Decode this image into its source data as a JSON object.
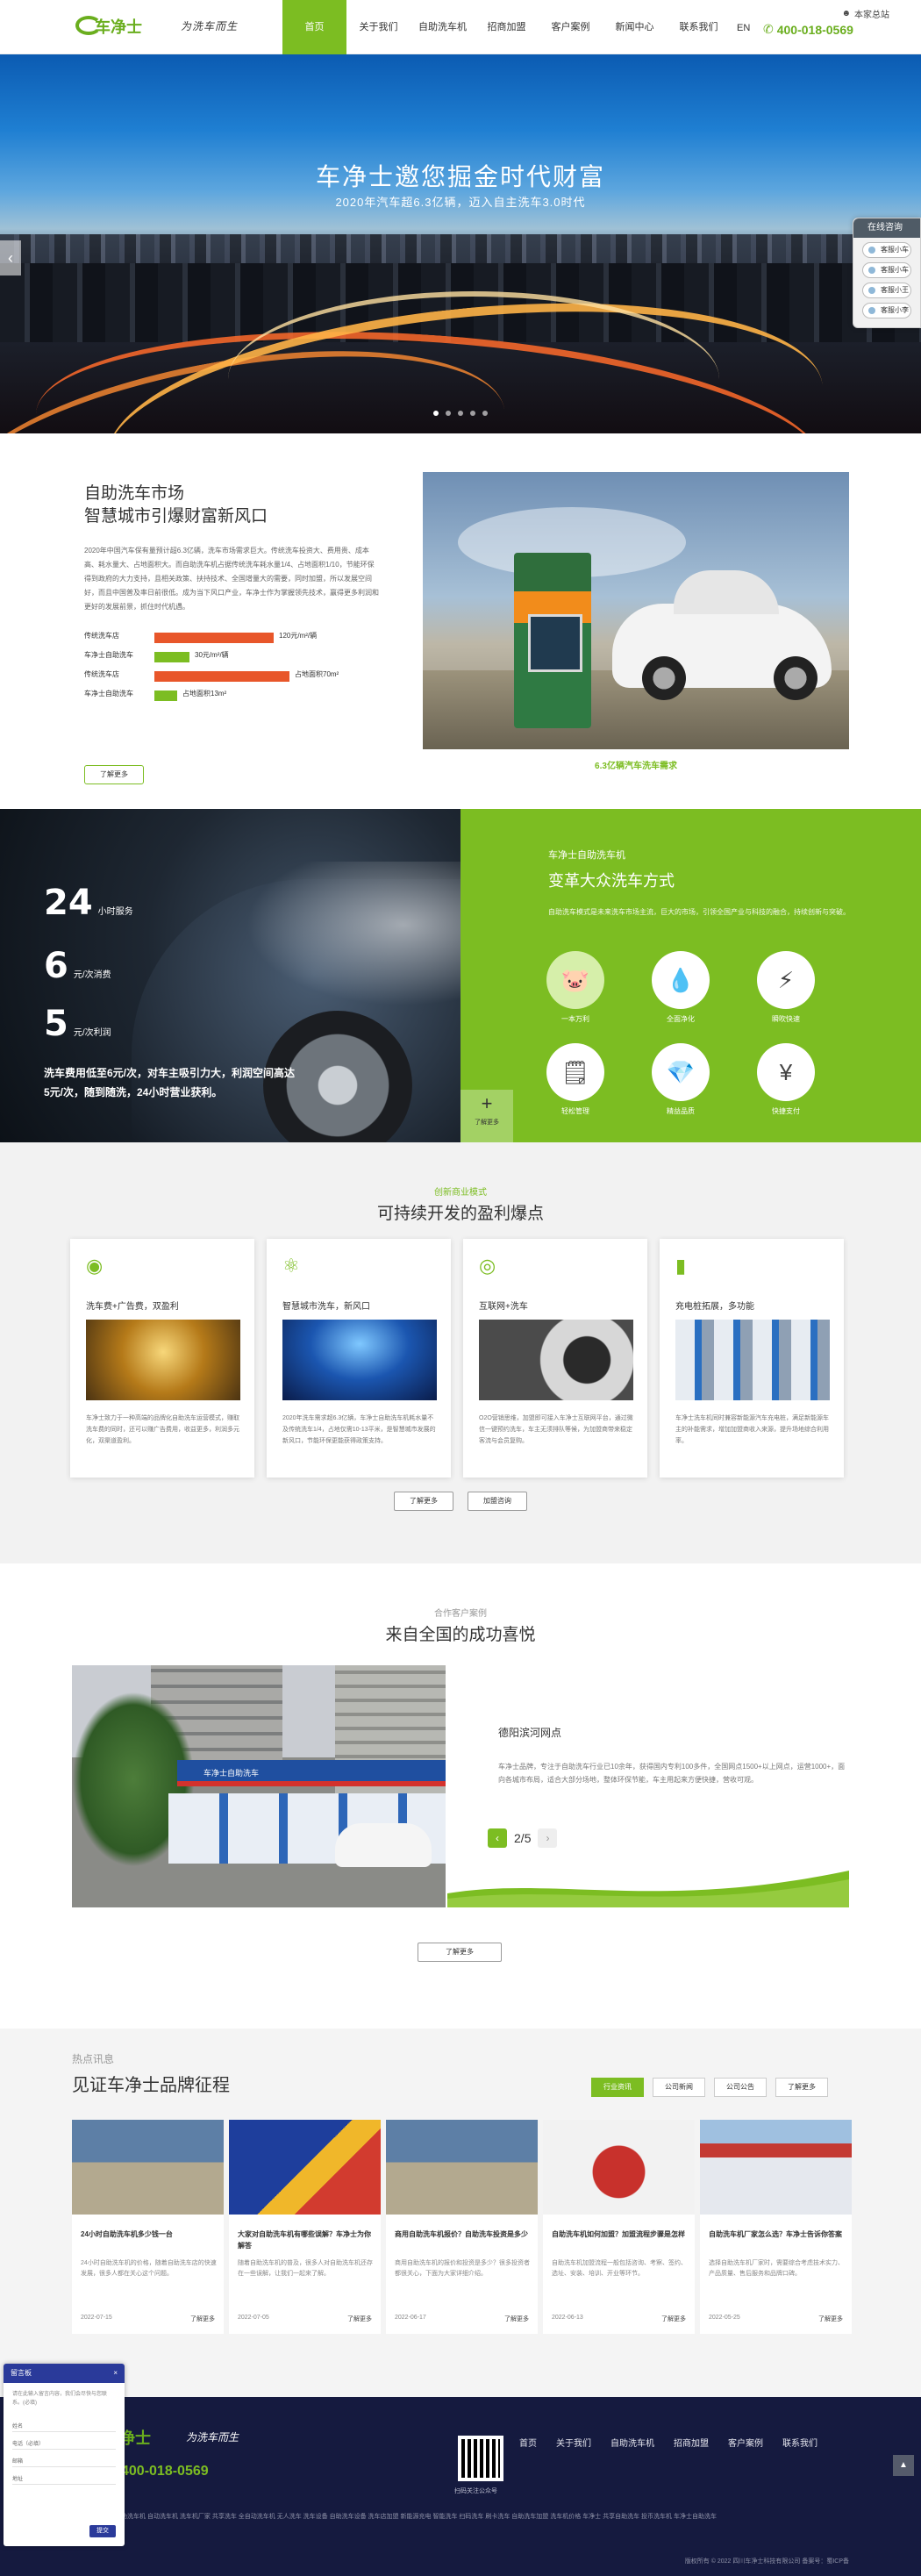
{
  "header": {
    "brand": "车净士",
    "slogan": "为洗车而生",
    "nav": [
      "首页",
      "关于我们",
      "自助洗车机",
      "招商加盟",
      "客户案例",
      "新闻中心",
      "联系我们"
    ],
    "hq_link": "本家总站",
    "lang": "EN",
    "hotline": "400-018-0569"
  },
  "banner": {
    "title": "车净士邀您掘金时代财富",
    "subtitle": "2020年汽车超6.3亿辆，迈入自主洗车3.0时代",
    "prev": "‹",
    "next": "›"
  },
  "float_panel": {
    "title": "在线咨询",
    "items": [
      "客服小车",
      "客服小车",
      "客服小王",
      "客服小李"
    ]
  },
  "market": {
    "title_line1": "自助洗车市场",
    "title_line2": "智慧城市引爆财富新风口",
    "desc": "2020年中国汽车保有量预计超6.3亿辆，洗车市场需求巨大。传统洗车投资大、费用贵、成本高、耗水量大、占地面积大。而自助洗车机占据传统洗车耗水量1/4、占地面积1/10，节能环保得到政府的大力支持，且相关政策、扶持技术、全国增量大的需要，同时加盟，所以发展空间好，而且中国普及率日前很低。成为当下风口产业，车净士作为掌握领先技术，赢得更多利润和更好的发展前景，抓住时代机遇。",
    "bars": [
      {
        "label": "传统洗车店",
        "value": "120元/m²/辆",
        "fill": 0.62,
        "color": "#e8562a"
      },
      {
        "label": "车净士自助洗车",
        "value": "30元/m²/辆",
        "fill": 0.18,
        "color": "#7cbd22"
      },
      {
        "label": "传统洗车店",
        "value": "占地面积70m²",
        "fill": 0.7,
        "color": "#e8562a"
      },
      {
        "label": "车净士自助洗车",
        "value": "占地面积13m²",
        "fill": 0.12,
        "color": "#7cbd22"
      }
    ],
    "learn_more": "了解更多",
    "photo_caption": "6.3亿辆汽车洗车需求"
  },
  "stats": {
    "items": [
      {
        "num": "24",
        "unit": "小时服务"
      },
      {
        "num": "6",
        "unit": "元/次消费"
      },
      {
        "num": "5",
        "unit": "元/次利润"
      }
    ],
    "text": "洗车费用低至6元/次，对车主吸引力大，利润空间高达5元/次，随到随洗，24小时营业获利。",
    "pre": "车净士自助洗车机",
    "title": "变革大众洗车方式",
    "desc": "自助洗车模式是未来洗车市场主流，巨大的市场，引领全国产业与科技的融合，持续创新与突破。",
    "features": [
      {
        "icon": "piggy-bank-icon",
        "glyph": "🐷",
        "label": "一本万利"
      },
      {
        "icon": "water-drops-icon",
        "glyph": "💧",
        "label": "全面净化"
      },
      {
        "icon": "lightning-icon",
        "glyph": "⚡",
        "label": "瞬吹快速"
      },
      {
        "icon": "document-edit-icon",
        "glyph": "🗒",
        "label": "轻松管理"
      },
      {
        "icon": "diamond-icon",
        "glyph": "💎",
        "label": "精益品质"
      },
      {
        "icon": "yuan-coin-icon",
        "glyph": "¥",
        "label": "快捷支付"
      }
    ],
    "corner_text": "了解更多"
  },
  "profit": {
    "pre": "创新商业模式",
    "title": "可持续开发的盈利爆点",
    "cards": [
      {
        "icon": "coins-icon",
        "title": "洗车费+广告费，双盈利",
        "desc": "车净士致力于一种高端的品牌化自助洗车运营模式，赚取洗车费的同时，还可以赚广告费用，收益更多，利润多元化，双渠道盈利。"
      },
      {
        "icon": "atom-network-icon",
        "title": "智慧城市洗车，新风口",
        "desc": "2020年洗车需求超6.3亿辆，车净士自助洗车机耗水量不及传统洗车1/4，占地仅需10-13平米，是智慧城市发展的新风口，节能环保更能获得政策支持。"
      },
      {
        "icon": "globe-icon",
        "title": "互联网+洗车",
        "desc": "O2O营销思维，加盟即可接入车净士互联网平台，通过微信一键预约洗车，车主无须排队等候，为加盟商带来稳定客流与会员复购。"
      },
      {
        "icon": "battery-charge-icon",
        "title": "充电桩拓展，多功能",
        "desc": "车净士洗车机同时兼容新能源汽车充电桩，满足新能源车主的补能需求，增加加盟商收入来源，提升场地综合利用率。"
      }
    ],
    "btn_more": "了解更多",
    "btn_join": "加盟咨询"
  },
  "cases": {
    "pre": "合作客户案例",
    "title": "来自全国的成功喜悦",
    "canopy_text": "车净士自助洗车",
    "case_title": "德阳滨河网点",
    "case_desc": "车净士品牌，专注于自助洗车行业已10余年，获得国内专利100多件，全国网点1500+以上网点，运营1000+，面向各城市布局，适合大部分场地，整体环保节能，车主用起来方便快捷，营收可观。",
    "page_current": "2",
    "page_total": "5",
    "more": "了解更多"
  },
  "news": {
    "pre": "热点讯息",
    "title": "见证车净士品牌征程",
    "tabs": [
      "行业资讯",
      "公司新闻",
      "公司公告",
      "了解更多"
    ],
    "items": [
      {
        "title": "24小时自助洗车机多少钱一台",
        "desc": "24小时自助洗车机的价格，随着自助洗车店的快速发展，很多人都在关心这个问题。",
        "date": "2022-07-15",
        "more": "了解更多"
      },
      {
        "title": "大家对自助洗车机有哪些误解？车净士为你解答",
        "desc": "随着自助洗车机的普及，很多人对自助洗车机还存在一些误解，让我们一起来了解。",
        "date": "2022-07-05",
        "more": "了解更多"
      },
      {
        "title": "商用自助洗车机报价？自助洗车投资是多少",
        "desc": "商用自助洗车机的报价和投资是多少？很多投资者都很关心，下面为大家详细介绍。",
        "date": "2022-06-17",
        "more": "了解更多"
      },
      {
        "title": "自助洗车机如何加盟？加盟流程步骤是怎样",
        "desc": "自助洗车机加盟流程一般包括咨询、考察、签约、选址、安装、培训、开业等环节。",
        "date": "2022-06-13",
        "more": "了解更多"
      },
      {
        "title": "自助洗车机厂家怎么选？车净士告诉你答案",
        "desc": "选择自助洗车机厂家时，需要综合考虑技术实力、产品质量、售后服务和品牌口碑。",
        "date": "2022-05-25",
        "more": "了解更多"
      }
    ]
  },
  "footer": {
    "phone": "400-018-0569",
    "qr_label": "扫码关注公众号",
    "nav": [
      "首页",
      "关于我们",
      "自助洗车机",
      "招商加盟",
      "客户案例",
      "联系我们"
    ],
    "links": "友情链接：自助洗车机  自动洗车机  洗车机厂家  共享洗车  全自动洗车机  无人洗车  洗车设备  自助洗车设备  洗车店加盟  新能源充电  智能洗车  扫码洗车  刷卡洗车  自助洗车加盟  洗车机价格  车净士  共享自助洗车  投币洗车机  车净士自助洗车",
    "copyright": "版权所有 © 2022 四川车净士科技有限公司  备案号：蜀ICP备"
  },
  "message": {
    "title": "留言板",
    "close": "×",
    "intro": "请在此输入留言内容，我们会尽快与您联系。(必填)",
    "fields": [
      "姓名",
      "电话（必填）",
      "邮箱",
      "地址"
    ],
    "submit": "提交"
  },
  "colors": {
    "brand_green": "#7cbd22",
    "footer_bg": "#151a3f",
    "accent_orange": "#e8562a"
  }
}
